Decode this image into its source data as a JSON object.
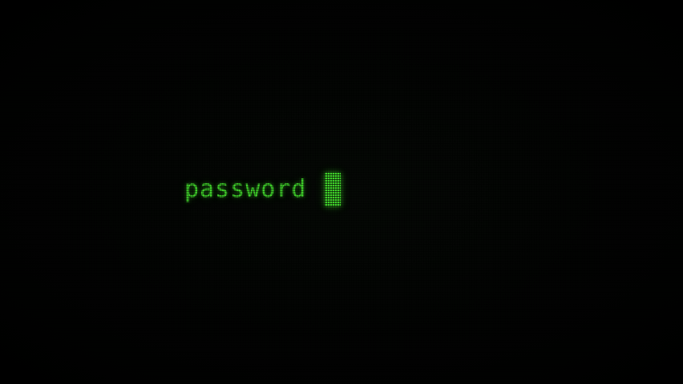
{
  "terminal": {
    "prompt_label": "password",
    "input_value": "",
    "text_color": "#3fcf2a",
    "background_color": "#000000"
  }
}
